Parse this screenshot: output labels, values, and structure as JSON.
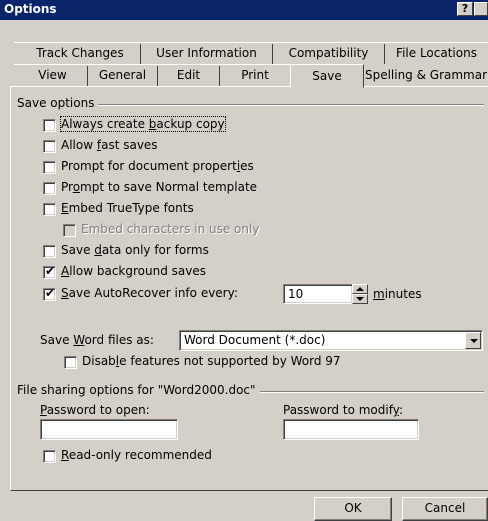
{
  "window": {
    "title": "Options",
    "help_button": "?",
    "close_button": "x"
  },
  "tabs_back": [
    {
      "label": "Track Changes"
    },
    {
      "label": "User Information"
    },
    {
      "label": "Compatibility"
    },
    {
      "label": "File Locations"
    }
  ],
  "tabs_front": [
    {
      "label": "View"
    },
    {
      "label": "General"
    },
    {
      "label": "Edit"
    },
    {
      "label": "Print"
    },
    {
      "label": "Save",
      "active": true
    },
    {
      "label": "Spelling & Grammar"
    }
  ],
  "save_options": {
    "group_label": "Save options",
    "items": [
      {
        "label_pre": "Always create ",
        "label_u": "b",
        "label_post": "ackup copy",
        "checked": false
      },
      {
        "label_pre": "Allow ",
        "label_u": "f",
        "label_post": "ast saves",
        "checked": false
      },
      {
        "label_pre": "Prompt for document propert",
        "label_u": "i",
        "label_post": "es",
        "checked": false
      },
      {
        "label_pre": "Pr",
        "label_u": "o",
        "label_post": "mpt to save Normal template",
        "checked": false
      },
      {
        "label_pre": "",
        "label_u": "E",
        "label_post": "mbed TrueType fonts",
        "checked": false
      },
      {
        "label_pre": "Embed characters in use only",
        "label_u": "",
        "label_post": "",
        "checked": false,
        "disabled": true
      },
      {
        "label_pre": "Save ",
        "label_u": "d",
        "label_post": "ata only for forms",
        "checked": false
      },
      {
        "label_pre": "",
        "label_u": "A",
        "label_post": "llow background saves",
        "checked": true
      },
      {
        "label_pre": "",
        "label_u": "S",
        "label_post": "ave AutoRecover info every:",
        "checked": true
      }
    ],
    "autorecover_value": "10",
    "minutes_label_u": "m",
    "minutes_label_post": "inutes"
  },
  "save_word_files": {
    "label_pre": "Save ",
    "label_u": "W",
    "label_post": "ord files as:",
    "selected": "Word Document (*.doc)",
    "disable_pre": "Disab",
    "disable_u": "l",
    "disable_post": "e features not supported by Word 97",
    "disable_checked": false
  },
  "file_sharing": {
    "group_label": "File sharing options for \"Word2000.doc\"",
    "password_open_u": "P",
    "password_open_post": "assword to open:",
    "password_modify_pre": "Password to modif",
    "password_modify_u": "y",
    "password_modify_post": ":",
    "password_open_value": "",
    "password_modify_value": "",
    "readonly_u": "R",
    "readonly_post": "ead-only recommended",
    "readonly_checked": false
  },
  "buttons": {
    "ok": "OK",
    "cancel": "Cancel"
  },
  "colors": {
    "title_bar": "#0a246a",
    "face": "#d4d0c8"
  }
}
